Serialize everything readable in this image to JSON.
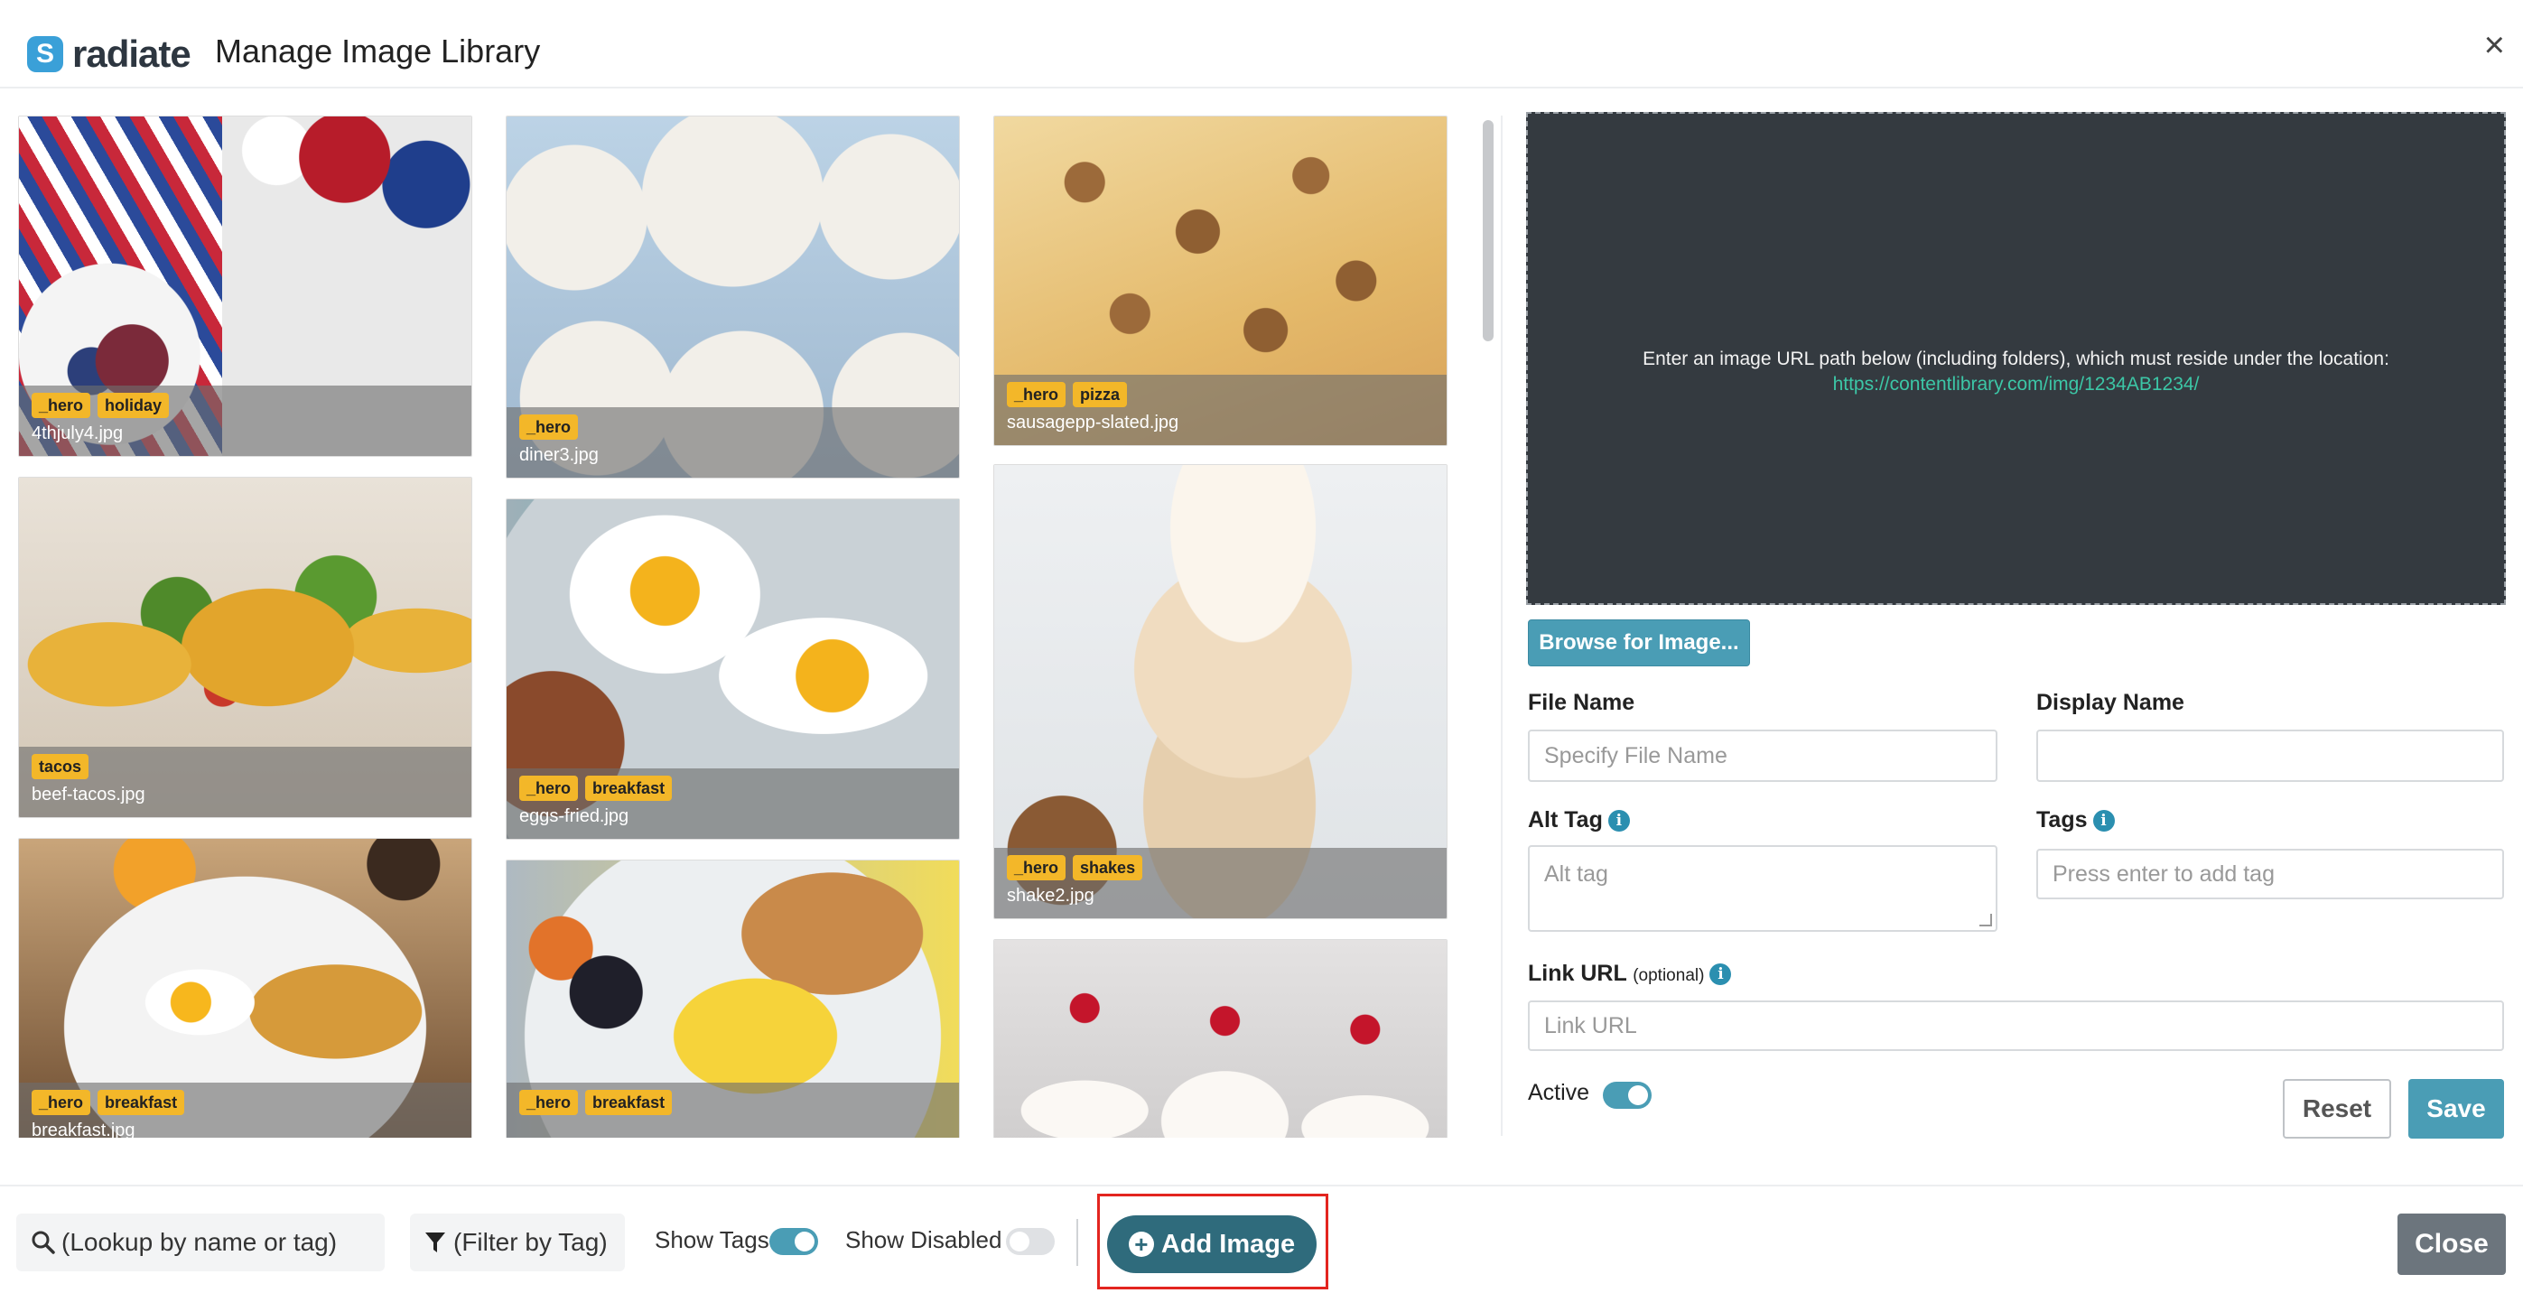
{
  "header": {
    "logo_text": "radiate",
    "logo_mark": "S",
    "title": "Manage Image Library",
    "close_icon": "×"
  },
  "gallery": {
    "tiles": [
      {
        "file": "4thjuly4.jpg",
        "tags": [
          "_hero",
          "holiday"
        ]
      },
      {
        "file": "beef-tacos.jpg",
        "tags": [
          "tacos"
        ]
      },
      {
        "file": "breakfast.jpg",
        "tags": [
          "_hero",
          "breakfast"
        ]
      },
      {
        "file": "diner3.jpg",
        "tags": [
          "_hero"
        ]
      },
      {
        "file": "eggs-fried.jpg",
        "tags": [
          "_hero",
          "breakfast"
        ]
      },
      {
        "file": "",
        "tags": [
          "_hero",
          "breakfast"
        ]
      },
      {
        "file": "sausagepp-slated.jpg",
        "tags": [
          "_hero",
          "pizza"
        ]
      },
      {
        "file": "shake2.jpg",
        "tags": [
          "_hero",
          "shakes"
        ]
      },
      {
        "file": "",
        "tags": []
      }
    ]
  },
  "upload": {
    "message": "Enter an image URL path below (including folders), which must reside under the location:",
    "url": "https://contentlibrary.com/img/1234AB1234/",
    "browse_label": "Browse for Image..."
  },
  "form": {
    "file_name_label": "File Name",
    "file_name_placeholder": "Specify File Name",
    "display_name_label": "Display Name",
    "display_name_value": "",
    "alt_tag_label": "Alt Tag",
    "alt_tag_placeholder": "Alt tag",
    "tags_label": "Tags",
    "tags_placeholder": "Press enter to add tag",
    "link_url_label": "Link URL",
    "link_url_optional": "(optional)",
    "link_url_placeholder": "Link URL",
    "active_label": "Active",
    "active": true,
    "reset_label": "Reset",
    "save_label": "Save"
  },
  "footer": {
    "search_placeholder": "(Lookup by name or tag)",
    "filter_label": "(Filter by Tag)",
    "show_tags_label": "Show Tags",
    "show_tags": true,
    "show_disabled_label": "Show Disabled",
    "show_disabled": false,
    "add_image_label": "Add Image",
    "close_label": "Close"
  },
  "colors": {
    "accent": "#4a9db5",
    "add_button": "#2f6b7c",
    "tag": "#f3b729",
    "highlight": "#e3251f",
    "dropzone": "#343a40"
  }
}
